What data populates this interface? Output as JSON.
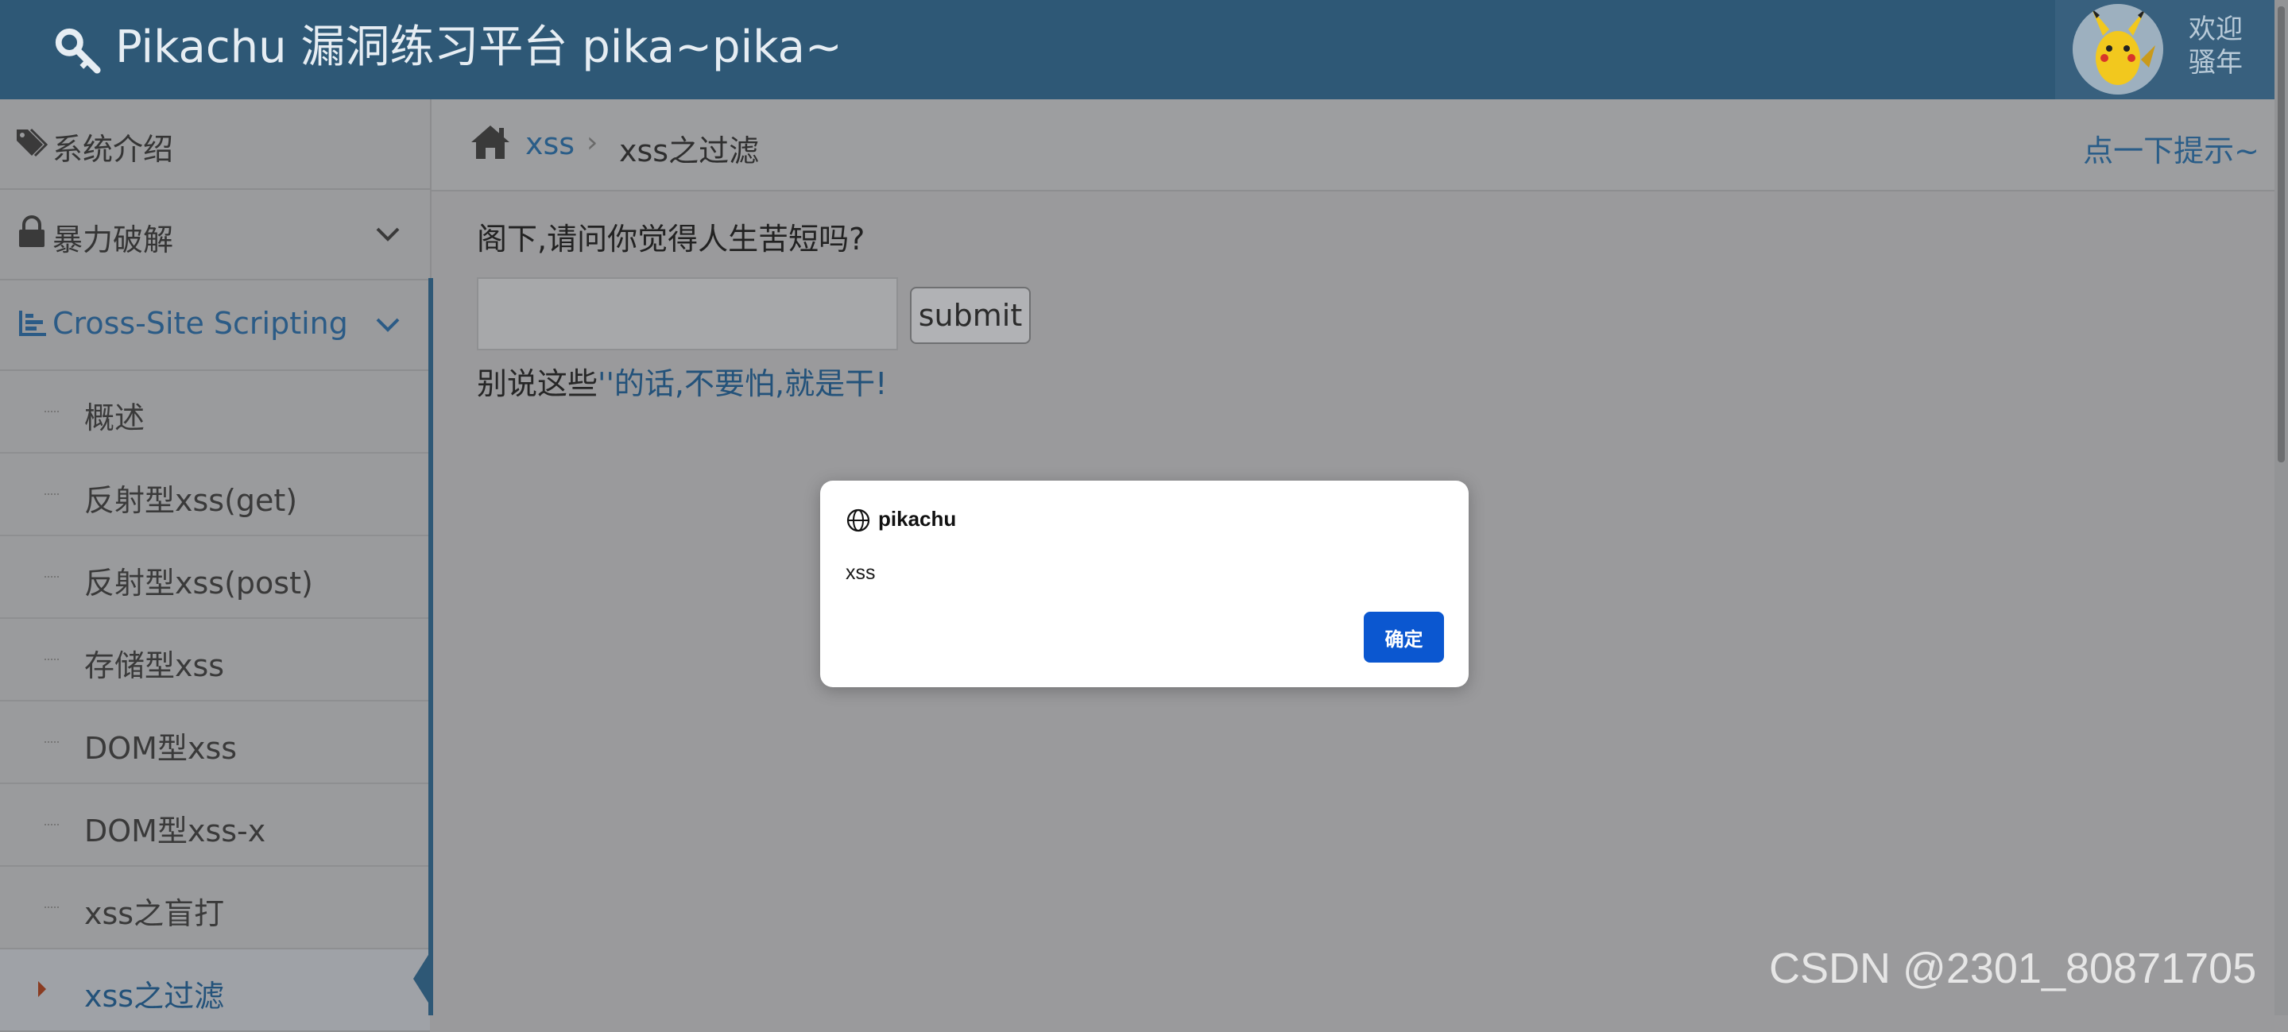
{
  "header": {
    "title": "Pikachu 漏洞练习平台 pika~pika~",
    "welcome_line1": "欢迎",
    "welcome_line2": "骚年"
  },
  "sidebar": {
    "items": [
      {
        "label": "系统介绍",
        "icon": "tag-icon"
      },
      {
        "label": "暴力破解",
        "icon": "lock-icon"
      },
      {
        "label": "Cross-Site Scripting",
        "icon": "tree-icon"
      }
    ],
    "sub_items": [
      {
        "label": "概述"
      },
      {
        "label": "反射型xss(get)"
      },
      {
        "label": "反射型xss(post)"
      },
      {
        "label": "存储型xss"
      },
      {
        "label": "DOM型xss"
      },
      {
        "label": "DOM型xss-x"
      },
      {
        "label": "xss之盲打"
      },
      {
        "label": "xss之过滤"
      }
    ]
  },
  "breadcrumb": {
    "link": "xss",
    "separator": "›",
    "current": "xss之过滤",
    "hint": "点一下提示~"
  },
  "main": {
    "question": "阁下,请问你觉得人生苦短吗?",
    "input_value": "",
    "submit_label": "submit",
    "result_prefix": "别说这些",
    "result_payload": "''的话,不要怕,就是干!"
  },
  "dialog": {
    "origin": "pikachu",
    "message": "xss",
    "ok_label": "确定"
  },
  "watermark": "CSDN @2301_80871705",
  "colors": {
    "header": "#2e5876",
    "accent": "#2b5b86",
    "dialog_button": "#0b57d0"
  }
}
